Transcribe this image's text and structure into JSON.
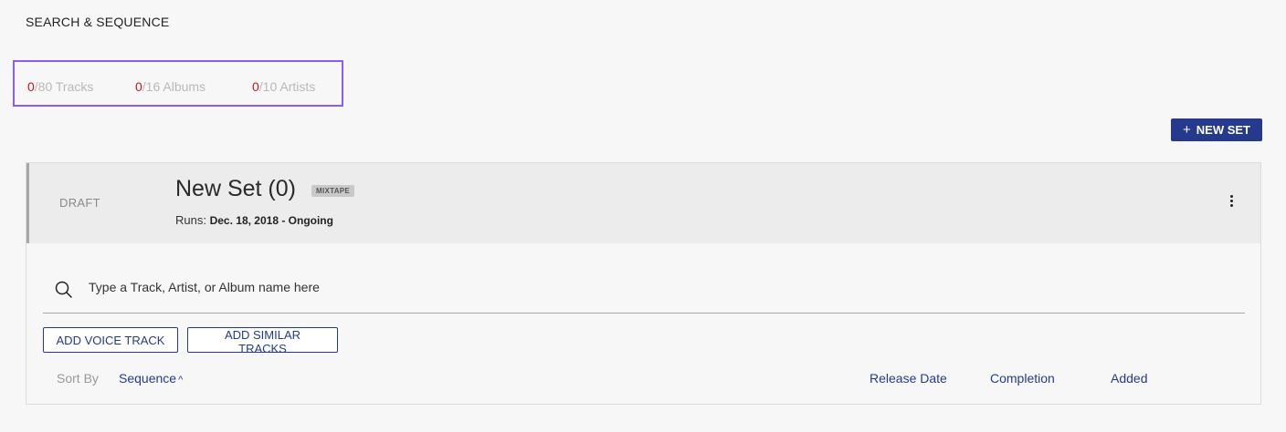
{
  "page": {
    "heading": "SEARCH & SEQUENCE"
  },
  "stats": {
    "tracks": {
      "count": "0",
      "total": "/80 Tracks"
    },
    "albums": {
      "count": "0",
      "total": "/16 Albums"
    },
    "artists": {
      "count": "0",
      "total": "/10 Artists"
    }
  },
  "toolbar": {
    "new_set_icon": "+",
    "new_set_label": "NEW SET"
  },
  "set": {
    "status": "DRAFT",
    "title": "New Set (0)",
    "badge": "MIXTAPE",
    "runs_label": "Runs:",
    "runs_value": "Dec. 18, 2018 - Ongoing",
    "menu_icon": "more-vertical-icon"
  },
  "search": {
    "icon": "search-icon",
    "placeholder": "Type a Track, Artist, or Album name here"
  },
  "actions": {
    "add_voice_track": "ADD VOICE TRACK",
    "add_similar_tracks": "ADD SIMILAR TRACKS"
  },
  "sort": {
    "label": "Sort By",
    "active": "Sequence",
    "active_chevron": "^",
    "options": [
      "Release Date",
      "Completion",
      "Added"
    ]
  },
  "colors": {
    "accent": "#253a8c",
    "highlight_count": "#c4141c",
    "stats_outline": "#8b5cf6"
  }
}
